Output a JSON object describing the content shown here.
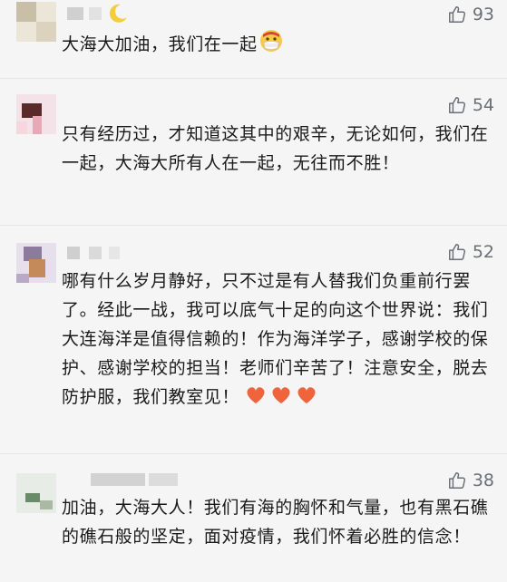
{
  "comments": [
    {
      "likes": "93",
      "text": "大海大加油，我们在一起",
      "emoji": "mask-face-emoji"
    },
    {
      "likes": "54",
      "text": "只有经历过，才知道这其中的艰辛，无论如何，我们在一起，大海大所有人在一起，无往而不胜！"
    },
    {
      "likes": "52",
      "text": "哪有什么岁月静好，只不过是有人替我们负重前行罢了。经此一战，我可以底气十足的向这个世界说：我们大连海洋是值得信赖的！作为海洋学子，感谢学校的保护、感谢学校的担当！老师们辛苦了！注意安全，脱去防护服，我们教室见！",
      "emoji": "heart-emoji-x3"
    },
    {
      "likes": "38",
      "text": "加油，大海大人！我们有海的胸怀和气量，也有黑石礁的礁石般的坚定，面对疫情，我们怀着必胜的信念！"
    }
  ],
  "colors": {
    "background": "#f5f5f5",
    "text": "#1a1a1a",
    "like": "#6a6f78",
    "heart": "#f0643c"
  }
}
